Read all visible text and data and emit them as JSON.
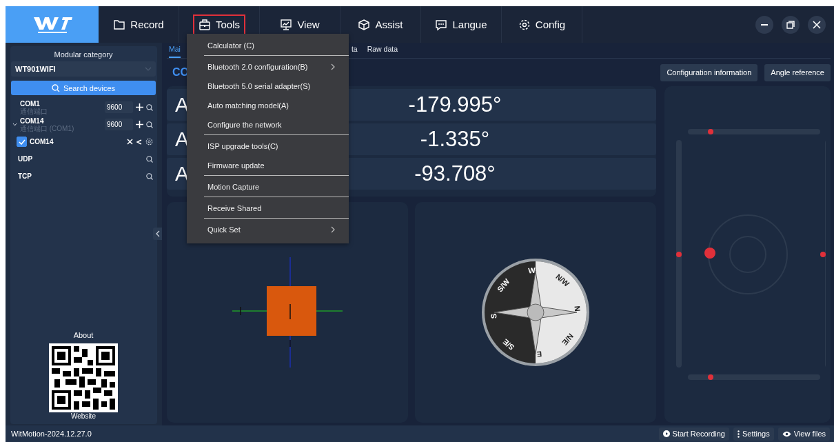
{
  "nav": {
    "items": [
      {
        "label": "Record",
        "selected": false
      },
      {
        "label": "Tools",
        "selected": true
      },
      {
        "label": "View",
        "selected": false
      },
      {
        "label": "Assist",
        "selected": false
      },
      {
        "label": "Langue",
        "selected": false
      },
      {
        "label": "Config",
        "selected": false
      }
    ]
  },
  "sidebar": {
    "category_label": "Modular category",
    "model_select": "WT901WIFI",
    "search_button": "Search devices",
    "devices": [
      {
        "kind": "port",
        "name": "COM1",
        "subtitle": "通信端口",
        "baud": "9600",
        "expanded": false
      },
      {
        "kind": "port",
        "name": "COM14",
        "subtitle": "通信端口 (COM1)",
        "baud": "9600",
        "expanded": true
      },
      {
        "kind": "child",
        "name": "COM14",
        "checked": true
      },
      {
        "kind": "net",
        "name": "UDP"
      },
      {
        "kind": "net",
        "name": "TCP"
      }
    ],
    "about_label": "About",
    "website_label": "Website"
  },
  "tabs": [
    {
      "label": "Mai",
      "selected": true
    },
    {
      "label": "ta",
      "selected": false
    },
    {
      "label": "Raw data",
      "selected": false
    }
  ],
  "device_title": "CO",
  "header_buttons": [
    "Configuration information",
    "Angle reference"
  ],
  "angles": [
    {
      "label": "A",
      "value": "-179.995°"
    },
    {
      "label": "A",
      "value": "-1.335°"
    },
    {
      "label": "A",
      "value": "-93.708°"
    }
  ],
  "compass_labels": [
    "W",
    "N/W",
    "N",
    "N/E",
    "E",
    "S/E",
    "S",
    "S/W"
  ],
  "tools_menu": [
    {
      "label": "Calculator (C)",
      "submenu": false,
      "divider_after": true
    },
    {
      "label": "Bluetooth 2.0 configuration(B)",
      "submenu": true,
      "divider_after": false
    },
    {
      "label": "Bluetooth 5.0 serial adapter(S)",
      "submenu": false,
      "divider_after": false
    },
    {
      "label": "Auto matching model(A)",
      "submenu": false,
      "divider_after": false
    },
    {
      "label": "Configure the network",
      "submenu": false,
      "divider_after": true
    },
    {
      "label": "ISP upgrade tools(C)",
      "submenu": false,
      "divider_after": false
    },
    {
      "label": "Firmware update",
      "submenu": false,
      "divider_after": true
    },
    {
      "label": "Motion Capture",
      "submenu": false,
      "divider_after": true
    },
    {
      "label": "Receive Shared",
      "submenu": false,
      "divider_after": true
    },
    {
      "label": "Quick Set",
      "submenu": true,
      "divider_after": false
    }
  ],
  "status_bar": {
    "version": "WitMotion-2024.12.27.0",
    "buttons": [
      "Start Recording",
      "Settings",
      "View files"
    ]
  }
}
